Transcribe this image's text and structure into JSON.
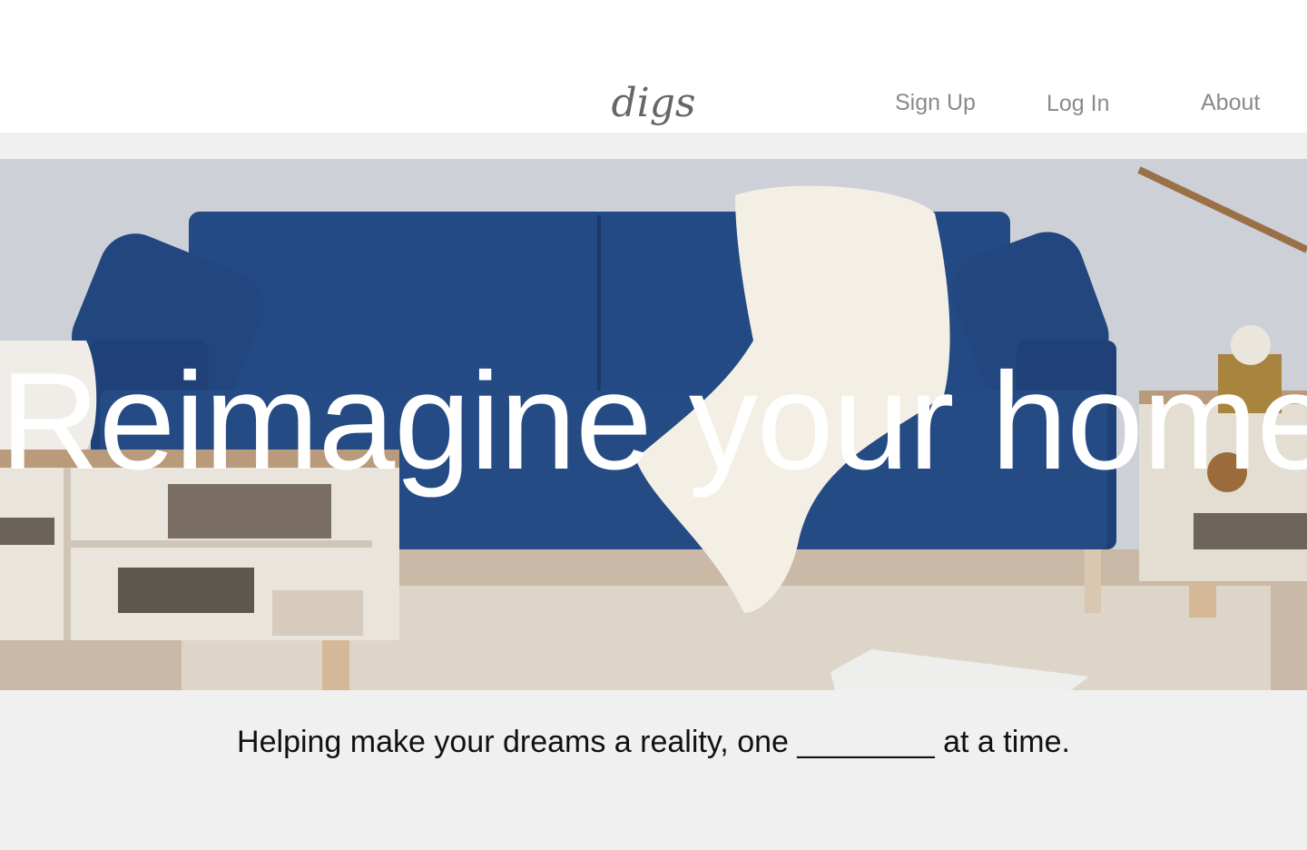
{
  "brand": {
    "logo_text": "digs"
  },
  "nav": {
    "signup_label": "Sign Up",
    "login_label": "Log In",
    "about_label": "About"
  },
  "hero": {
    "title": "Reimagine your home",
    "image_desc_icon": "living-room-photo"
  },
  "tagline": {
    "text": "Helping make your dreams a reality, one ________ at a time."
  },
  "colors": {
    "header_bg": "#ffffff",
    "page_bg": "#f0f0f0",
    "nav_text": "#8a8a8a",
    "sofa_blue": "#1f3f73",
    "hero_text": "#ffffff"
  }
}
